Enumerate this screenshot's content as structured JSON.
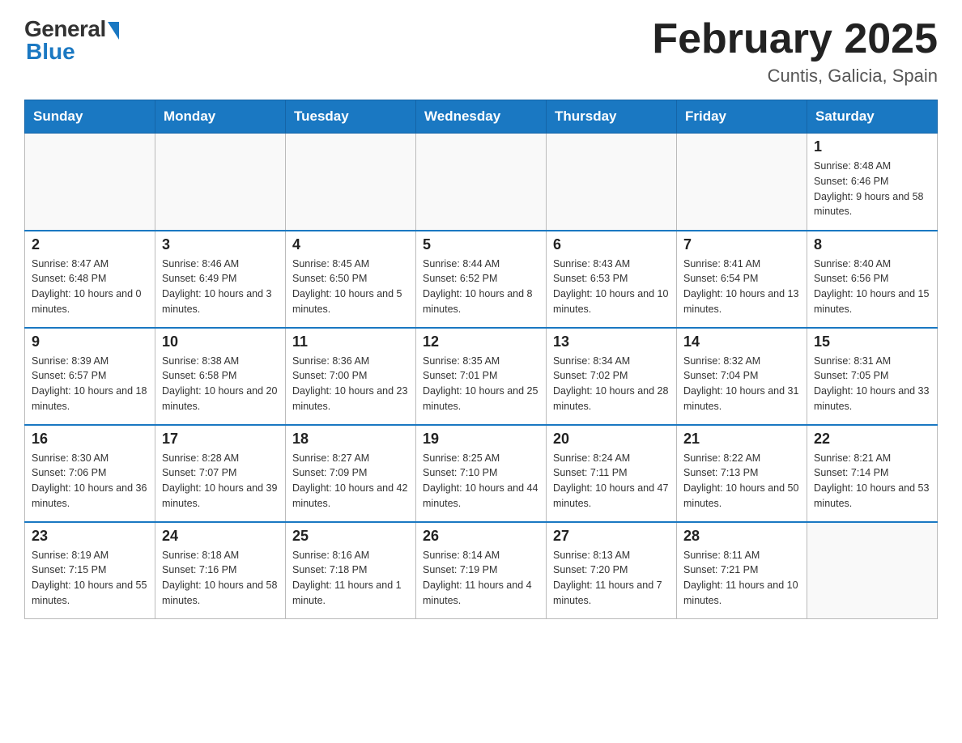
{
  "header": {
    "logo_general": "General",
    "logo_blue": "Blue",
    "month_title": "February 2025",
    "location": "Cuntis, Galicia, Spain"
  },
  "days_of_week": [
    "Sunday",
    "Monday",
    "Tuesday",
    "Wednesday",
    "Thursday",
    "Friday",
    "Saturday"
  ],
  "weeks": [
    [
      {
        "day": "",
        "info": ""
      },
      {
        "day": "",
        "info": ""
      },
      {
        "day": "",
        "info": ""
      },
      {
        "day": "",
        "info": ""
      },
      {
        "day": "",
        "info": ""
      },
      {
        "day": "",
        "info": ""
      },
      {
        "day": "1",
        "info": "Sunrise: 8:48 AM\nSunset: 6:46 PM\nDaylight: 9 hours and 58 minutes."
      }
    ],
    [
      {
        "day": "2",
        "info": "Sunrise: 8:47 AM\nSunset: 6:48 PM\nDaylight: 10 hours and 0 minutes."
      },
      {
        "day": "3",
        "info": "Sunrise: 8:46 AM\nSunset: 6:49 PM\nDaylight: 10 hours and 3 minutes."
      },
      {
        "day": "4",
        "info": "Sunrise: 8:45 AM\nSunset: 6:50 PM\nDaylight: 10 hours and 5 minutes."
      },
      {
        "day": "5",
        "info": "Sunrise: 8:44 AM\nSunset: 6:52 PM\nDaylight: 10 hours and 8 minutes."
      },
      {
        "day": "6",
        "info": "Sunrise: 8:43 AM\nSunset: 6:53 PM\nDaylight: 10 hours and 10 minutes."
      },
      {
        "day": "7",
        "info": "Sunrise: 8:41 AM\nSunset: 6:54 PM\nDaylight: 10 hours and 13 minutes."
      },
      {
        "day": "8",
        "info": "Sunrise: 8:40 AM\nSunset: 6:56 PM\nDaylight: 10 hours and 15 minutes."
      }
    ],
    [
      {
        "day": "9",
        "info": "Sunrise: 8:39 AM\nSunset: 6:57 PM\nDaylight: 10 hours and 18 minutes."
      },
      {
        "day": "10",
        "info": "Sunrise: 8:38 AM\nSunset: 6:58 PM\nDaylight: 10 hours and 20 minutes."
      },
      {
        "day": "11",
        "info": "Sunrise: 8:36 AM\nSunset: 7:00 PM\nDaylight: 10 hours and 23 minutes."
      },
      {
        "day": "12",
        "info": "Sunrise: 8:35 AM\nSunset: 7:01 PM\nDaylight: 10 hours and 25 minutes."
      },
      {
        "day": "13",
        "info": "Sunrise: 8:34 AM\nSunset: 7:02 PM\nDaylight: 10 hours and 28 minutes."
      },
      {
        "day": "14",
        "info": "Sunrise: 8:32 AM\nSunset: 7:04 PM\nDaylight: 10 hours and 31 minutes."
      },
      {
        "day": "15",
        "info": "Sunrise: 8:31 AM\nSunset: 7:05 PM\nDaylight: 10 hours and 33 minutes."
      }
    ],
    [
      {
        "day": "16",
        "info": "Sunrise: 8:30 AM\nSunset: 7:06 PM\nDaylight: 10 hours and 36 minutes."
      },
      {
        "day": "17",
        "info": "Sunrise: 8:28 AM\nSunset: 7:07 PM\nDaylight: 10 hours and 39 minutes."
      },
      {
        "day": "18",
        "info": "Sunrise: 8:27 AM\nSunset: 7:09 PM\nDaylight: 10 hours and 42 minutes."
      },
      {
        "day": "19",
        "info": "Sunrise: 8:25 AM\nSunset: 7:10 PM\nDaylight: 10 hours and 44 minutes."
      },
      {
        "day": "20",
        "info": "Sunrise: 8:24 AM\nSunset: 7:11 PM\nDaylight: 10 hours and 47 minutes."
      },
      {
        "day": "21",
        "info": "Sunrise: 8:22 AM\nSunset: 7:13 PM\nDaylight: 10 hours and 50 minutes."
      },
      {
        "day": "22",
        "info": "Sunrise: 8:21 AM\nSunset: 7:14 PM\nDaylight: 10 hours and 53 minutes."
      }
    ],
    [
      {
        "day": "23",
        "info": "Sunrise: 8:19 AM\nSunset: 7:15 PM\nDaylight: 10 hours and 55 minutes."
      },
      {
        "day": "24",
        "info": "Sunrise: 8:18 AM\nSunset: 7:16 PM\nDaylight: 10 hours and 58 minutes."
      },
      {
        "day": "25",
        "info": "Sunrise: 8:16 AM\nSunset: 7:18 PM\nDaylight: 11 hours and 1 minute."
      },
      {
        "day": "26",
        "info": "Sunrise: 8:14 AM\nSunset: 7:19 PM\nDaylight: 11 hours and 4 minutes."
      },
      {
        "day": "27",
        "info": "Sunrise: 8:13 AM\nSunset: 7:20 PM\nDaylight: 11 hours and 7 minutes."
      },
      {
        "day": "28",
        "info": "Sunrise: 8:11 AM\nSunset: 7:21 PM\nDaylight: 11 hours and 10 minutes."
      },
      {
        "day": "",
        "info": ""
      }
    ]
  ]
}
